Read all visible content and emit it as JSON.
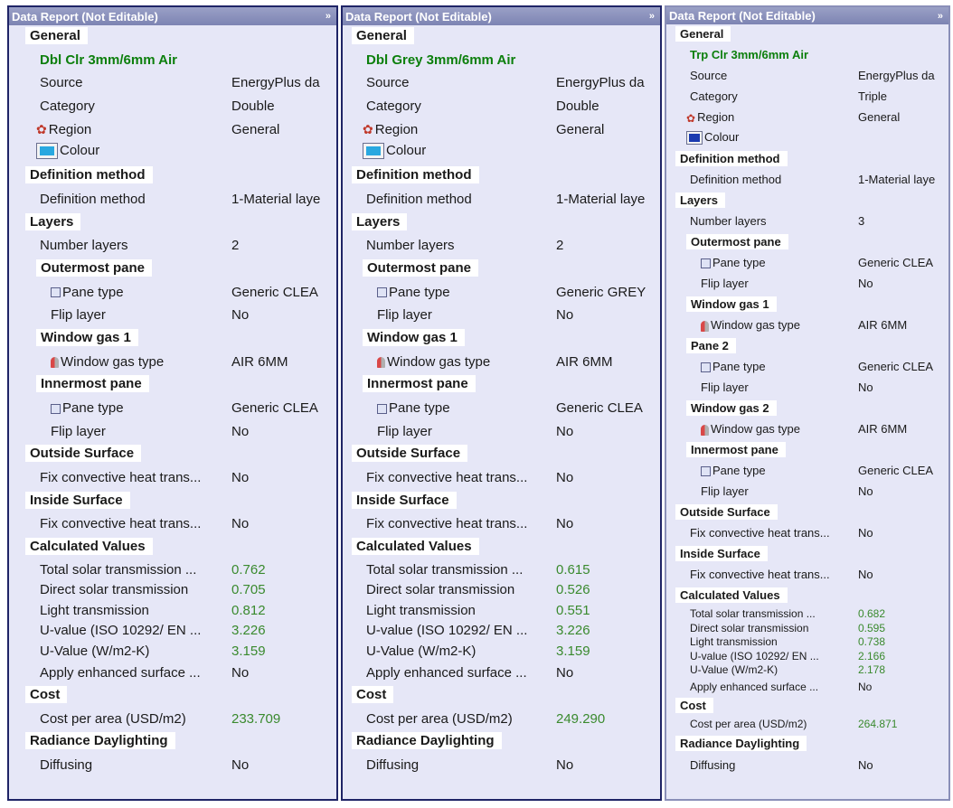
{
  "panels": [
    {
      "title": "Data Report (Not Editable)",
      "glazing_name": "Dbl Clr 3mm/6mm Air",
      "general": {
        "heading": "General",
        "source_label": "Source",
        "source_value": "EnergyPlus da",
        "category_label": "Category",
        "category_value": "Double",
        "region_label": "Region",
        "region_value": "General",
        "colour_label": "Colour"
      },
      "definition": {
        "heading": "Definition method",
        "label": "Definition method",
        "value": "1-Material laye"
      },
      "layers": {
        "heading": "Layers",
        "number_label": "Number layers",
        "number_value": "2",
        "outer": {
          "heading": "Outermost pane",
          "pane_type_label": "Pane type",
          "pane_type_value": "Generic CLEA",
          "flip_label": "Flip layer",
          "flip_value": "No"
        },
        "gas1": {
          "heading": "Window gas 1",
          "label": "Window gas type",
          "value": "AIR 6MM"
        },
        "inner": {
          "heading": "Innermost pane",
          "pane_type_label": "Pane type",
          "pane_type_value": "Generic CLEA",
          "flip_label": "Flip layer",
          "flip_value": "No"
        }
      },
      "outside": {
        "heading": "Outside Surface",
        "label": "Fix convective heat trans...",
        "value": "No"
      },
      "inside": {
        "heading": "Inside Surface",
        "label": "Fix convective heat trans...",
        "value": "No"
      },
      "calc": {
        "heading": "Calculated Values",
        "tst_label": "Total solar transmission ...",
        "tst_value": "0.762",
        "dst_label": "Direct solar transmission",
        "dst_value": "0.705",
        "lt_label": "Light transmission",
        "lt_value": "0.812",
        "uiso_label": "U-value (ISO 10292/ EN ...",
        "uiso_value": "3.226",
        "u_label": "U-Value (W/m2-K)",
        "u_value": "3.159",
        "aes_label": "Apply enhanced surface ...",
        "aes_value": "No"
      },
      "cost": {
        "heading": "Cost",
        "label": "Cost per area (USD/m2)",
        "value": "233.709"
      },
      "radiance": {
        "heading": "Radiance Daylighting",
        "label": "Diffusing",
        "value": "No"
      }
    },
    {
      "title": "Data Report (Not Editable)",
      "glazing_name": "Dbl Grey 3mm/6mm Air",
      "general": {
        "heading": "General",
        "source_label": "Source",
        "source_value": "EnergyPlus da",
        "category_label": "Category",
        "category_value": "Double",
        "region_label": "Region",
        "region_value": "General",
        "colour_label": "Colour"
      },
      "definition": {
        "heading": "Definition method",
        "label": "Definition method",
        "value": "1-Material laye"
      },
      "layers": {
        "heading": "Layers",
        "number_label": "Number layers",
        "number_value": "2",
        "outer": {
          "heading": "Outermost pane",
          "pane_type_label": "Pane type",
          "pane_type_value": "Generic GREY",
          "flip_label": "Flip layer",
          "flip_value": "No"
        },
        "gas1": {
          "heading": "Window gas 1",
          "label": "Window gas type",
          "value": "AIR 6MM"
        },
        "inner": {
          "heading": "Innermost pane",
          "pane_type_label": "Pane type",
          "pane_type_value": "Generic CLEA",
          "flip_label": "Flip layer",
          "flip_value": "No"
        }
      },
      "outside": {
        "heading": "Outside Surface",
        "label": "Fix convective heat trans...",
        "value": "No"
      },
      "inside": {
        "heading": "Inside Surface",
        "label": "Fix convective heat trans...",
        "value": "No"
      },
      "calc": {
        "heading": "Calculated Values",
        "tst_label": "Total solar transmission ...",
        "tst_value": "0.615",
        "dst_label": "Direct solar transmission",
        "dst_value": "0.526",
        "lt_label": "Light transmission",
        "lt_value": "0.551",
        "uiso_label": "U-value (ISO 10292/ EN ...",
        "uiso_value": "3.226",
        "u_label": "U-Value (W/m2-K)",
        "u_value": "3.159",
        "aes_label": "Apply enhanced surface ...",
        "aes_value": "No"
      },
      "cost": {
        "heading": "Cost",
        "label": "Cost per area (USD/m2)",
        "value": "249.290"
      },
      "radiance": {
        "heading": "Radiance Daylighting",
        "label": "Diffusing",
        "value": "No"
      }
    },
    {
      "title": "Data Report (Not Editable)",
      "glazing_name": "Trp Clr 3mm/6mm Air",
      "general": {
        "heading": "General",
        "source_label": "Source",
        "source_value": "EnergyPlus da",
        "category_label": "Category",
        "category_value": "Triple",
        "region_label": "Region",
        "region_value": "General",
        "colour_label": "Colour"
      },
      "definition": {
        "heading": "Definition method",
        "label": "Definition method",
        "value": "1-Material laye"
      },
      "layers": {
        "heading": "Layers",
        "number_label": "Number layers",
        "number_value": "3",
        "outer": {
          "heading": "Outermost pane",
          "pane_type_label": "Pane type",
          "pane_type_value": "Generic CLEA",
          "flip_label": "Flip layer",
          "flip_value": "No"
        },
        "gas1": {
          "heading": "Window gas 1",
          "label": "Window gas type",
          "value": "AIR 6MM"
        },
        "pane2": {
          "heading": "Pane 2",
          "pane_type_label": "Pane type",
          "pane_type_value": "Generic CLEA",
          "flip_label": "Flip layer",
          "flip_value": "No"
        },
        "gas2": {
          "heading": "Window gas 2",
          "label": "Window gas type",
          "value": "AIR 6MM"
        },
        "inner": {
          "heading": "Innermost pane",
          "pane_type_label": "Pane type",
          "pane_type_value": "Generic CLEA",
          "flip_label": "Flip layer",
          "flip_value": "No"
        }
      },
      "outside": {
        "heading": "Outside Surface",
        "label": "Fix convective heat trans...",
        "value": "No"
      },
      "inside": {
        "heading": "Inside Surface",
        "label": "Fix convective heat trans...",
        "value": "No"
      },
      "calc": {
        "heading": "Calculated Values",
        "tst_label": "Total solar transmission ...",
        "tst_value": "0.682",
        "dst_label": "Direct solar transmission",
        "dst_value": "0.595",
        "lt_label": "Light transmission",
        "lt_value": "0.738",
        "uiso_label": "U-value (ISO 10292/ EN ...",
        "uiso_value": "2.166",
        "u_label": "U-Value (W/m2-K)",
        "u_value": "2.178",
        "aes_label": "Apply enhanced surface ...",
        "aes_value": "No"
      },
      "cost": {
        "heading": "Cost",
        "label": "Cost per area (USD/m2)",
        "value": "264.871"
      },
      "radiance": {
        "heading": "Radiance Daylighting",
        "label": "Diffusing",
        "value": "No"
      }
    }
  ],
  "icons": {
    "collapse": "double-chevron-icon",
    "region": "region-globe-icon",
    "colour": "colour-swatch-icon",
    "pane": "pane-type-icon",
    "gas": "window-gas-icon"
  },
  "colors": {
    "panel_background": "#e6e7f7",
    "title_bar": "#8a90bd",
    "panel_border": "#1f2466",
    "value_green": "#3a8a2e",
    "name_green": "#0c7f0c"
  }
}
